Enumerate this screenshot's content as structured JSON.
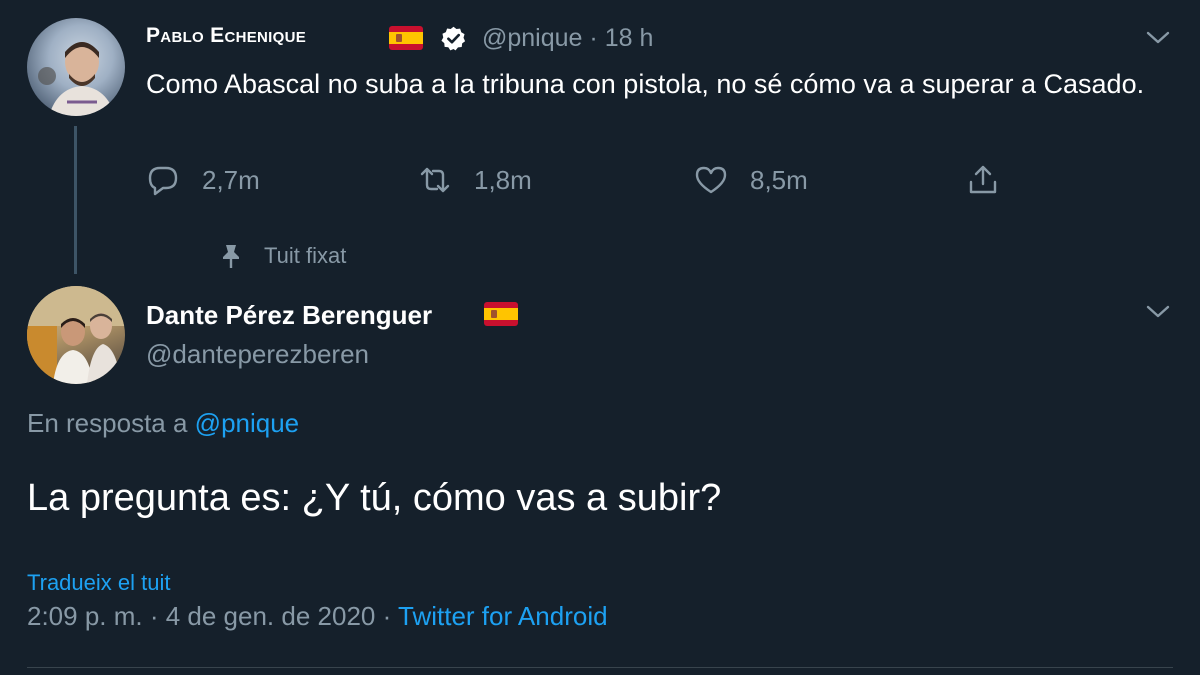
{
  "theme": {
    "background": "#15202b",
    "accent": "#1da1f2",
    "muted": "#8899a6",
    "text": "#ffffff"
  },
  "tweet1": {
    "author_name": "Pablo Echenique",
    "flag_icon": "spain-flag-icon",
    "verified_icon": "verified-badge-icon",
    "handle": "@pnique",
    "separator": "·",
    "time": "18 h",
    "text": "Como Abascal no suba a la tribuna con pistola, no sé cómo va a superar a Casado.",
    "actions": {
      "reply_count": "2,7m",
      "retweet_count": "1,8m",
      "like_count": "8,5m"
    },
    "pinned_label": "Tuit fixat"
  },
  "tweet2": {
    "author_name": "Dante Pérez Berenguer",
    "flag_icon": "spain-flag-icon",
    "handle": "@danteperezberen",
    "reply_prefix": "En resposta a",
    "reply_to": "@pnique",
    "text": "La pregunta es: ¿Y tú, cómo vas a subir?",
    "translate_label": "Tradueix el tuit",
    "timestamp": "2:09 p. m. · 4 de gen. de 2020 ·",
    "source": "Twitter for Android"
  }
}
